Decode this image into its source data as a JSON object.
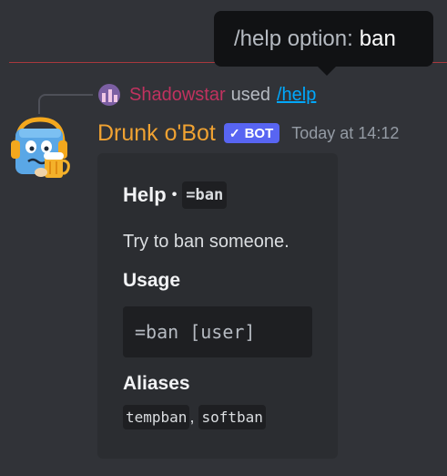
{
  "tooltip": {
    "prefix": "/help option:",
    "value": "ban"
  },
  "reply": {
    "username": "Shadowstar",
    "used_text": "used",
    "command": "/help",
    "username_color": "#c0325f"
  },
  "message": {
    "author": "Drunk o'Bot",
    "author_color": "#f0a232",
    "bot_tag": "BOT",
    "timestamp": "Today at 14:12"
  },
  "embed": {
    "title": "Help",
    "title_separator": "•",
    "title_code": "=ban",
    "description": "Try to ban someone.",
    "fields": [
      {
        "name": "Usage",
        "code_block": "=ban [user]"
      },
      {
        "name": "Aliases",
        "aliases": [
          "tempban",
          "softban"
        ],
        "separator": ","
      }
    ]
  },
  "icons": {
    "reply_avatar": "user-avatar-icon",
    "bot_avatar": "bot-avatar-icon",
    "bot_tag_check": "checkmark-icon"
  },
  "colors": {
    "background": "#313338",
    "embed_background": "#2b2d31",
    "link": "#00a8fc",
    "bot_tag": "#5865f2"
  }
}
